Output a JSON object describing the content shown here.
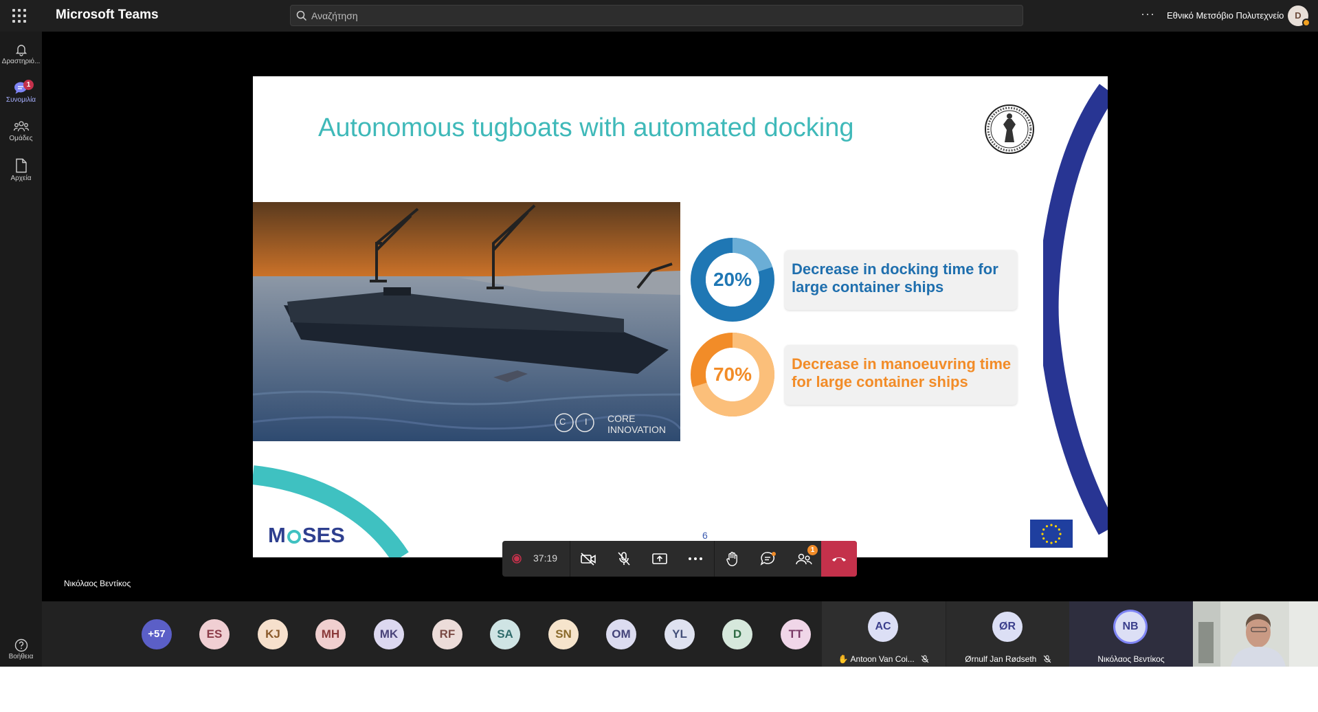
{
  "app": {
    "title": "Microsoft Teams"
  },
  "search": {
    "placeholder": "Αναζήτηση"
  },
  "header": {
    "more_label": "···",
    "org": "Εθνικό Μετσόβιο Πολυτεχνείο",
    "avatar_initial": "D"
  },
  "rail": {
    "items": [
      {
        "label": "Δραστηριό...",
        "icon": "bell-icon"
      },
      {
        "label": "Συνομιλία",
        "icon": "chat-icon",
        "badge": "1"
      },
      {
        "label": "Ομάδες",
        "icon": "teams-icon"
      },
      {
        "label": "Αρχεία",
        "icon": "file-icon"
      }
    ],
    "help_label": "Βοήθεια"
  },
  "slide": {
    "title": "Autonomous tugboats with automated docking",
    "stats": [
      {
        "value": "20%",
        "text": "Decrease in docking time for large container ships",
        "color": "#1f77b4"
      },
      {
        "value": "70%",
        "text": "Decrease in manoeuvring time for large container ships",
        "color": "#f28c28"
      }
    ],
    "video_watermark_line1": "CORE",
    "video_watermark_line2": "INNOVATION",
    "video_watermark_logo": "C I",
    "logo_text_1": "M",
    "logo_text_2": "SES",
    "page_number": "6"
  },
  "presenter": {
    "name": "Νικόλαος Βεντίκος"
  },
  "controls": {
    "timer": "37:19",
    "participants_badge": "1"
  },
  "participants": {
    "overflow": "+57",
    "avatars": [
      {
        "initials": "ES",
        "bg": "#f0cfd3",
        "fg": "#8a3a47"
      },
      {
        "initials": "KJ",
        "bg": "#f6e0cc",
        "fg": "#8a5a2b"
      },
      {
        "initials": "MH",
        "bg": "#f0cfcf",
        "fg": "#8a3a3a"
      },
      {
        "initials": "MK",
        "bg": "#dcd8f0",
        "fg": "#4a447a"
      },
      {
        "initials": "RF",
        "bg": "#ecdcd9",
        "fg": "#7a4a44"
      },
      {
        "initials": "SA",
        "bg": "#cfe4e4",
        "fg": "#2f6b6b"
      },
      {
        "initials": "SN",
        "bg": "#f6e4cc",
        "fg": "#8a6a2b"
      },
      {
        "initials": "OM",
        "bg": "#dcdcf0",
        "fg": "#44447a"
      },
      {
        "initials": "YL",
        "bg": "#dfe2f0",
        "fg": "#44507a"
      },
      {
        "initials": "D",
        "bg": "#d6e8dc",
        "fg": "#2f6b44"
      },
      {
        "initials": "TT",
        "bg": "#f0d6e8",
        "fg": "#7a3a66"
      }
    ],
    "tiles": [
      {
        "initials": "AC",
        "name": "Antoon Van Coi...",
        "hand": "✋"
      },
      {
        "initials": "ØR",
        "name": "Ørnulf Jan Rødseth"
      },
      {
        "initials": "NB",
        "name": "Νικόλαος Βεντίκος"
      }
    ]
  }
}
